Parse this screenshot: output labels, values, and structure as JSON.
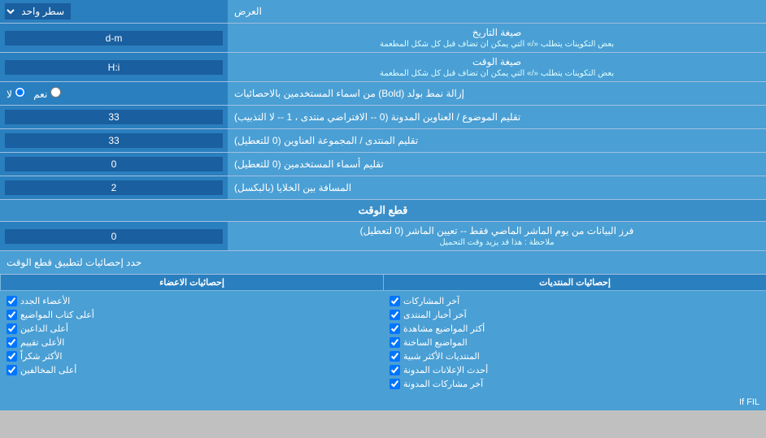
{
  "header": {
    "dropdown_label": "سطر واحد",
    "right_label": "العرض"
  },
  "rows": [
    {
      "id": "date_format",
      "label": "صيغة التاريخ",
      "sublabel": "بعض التكوينات يتطلب «/» التي يمكن ان تضاف قبل كل شكل المطعمة",
      "value": "d-m",
      "type": "text"
    },
    {
      "id": "time_format",
      "label": "صيغة الوقت",
      "sublabel": "بعض التكوينات يتطلب «/» التي يمكن ان تضاف قبل كل شكل المطعمة",
      "value": "H:i",
      "type": "text"
    },
    {
      "id": "bold_remove",
      "label": "إزالة نمط بولد (Bold) من اسماء المستخدمين بالاحصائيات",
      "radio_yes": "نعم",
      "radio_no": "لا",
      "selected": "no",
      "type": "radio"
    },
    {
      "id": "forum_topic",
      "label": "تقليم الموضوع / العناوين المدونة (0 -- الافتراضي منتدى ، 1 -- لا التذبيب)",
      "value": "33",
      "type": "text"
    },
    {
      "id": "forum_group",
      "label": "تقليم المنتدى / المجموعة العناوين (0 للتعطيل)",
      "value": "33",
      "type": "text"
    },
    {
      "id": "user_names",
      "label": "تقليم أسماء المستخدمين (0 للتعطيل)",
      "value": "0",
      "type": "text"
    },
    {
      "id": "entry_distance",
      "label": "المسافة بين الخلايا (بالبكسل)",
      "value": "2",
      "type": "text"
    }
  ],
  "time_cutoff_section": {
    "title": "قطع الوقت",
    "row_label": "فرز البيانات من يوم الماشر الماضي فقط -- تعيين الماشر (0 لتعطيل)",
    "row_note": "ملاحظة : هذا قد يزيد وقت التحميل",
    "row_value": "0"
  },
  "stats_section": {
    "apply_label": "حدد إحصائيات لتطبيق قطع الوقت",
    "col1_header": "إحصائيات المنتديات",
    "col2_header": "إحصائيات الاعضاء",
    "col1_items": [
      "آخر المشاركات",
      "آخر أخبار المنتدى",
      "أكثر المواضيع مشاهدة",
      "المواضيع الساخنة",
      "المنتديات الأكثر شبية",
      "أحدث الإعلانات المدونة",
      "آخر مشاركات المدونة"
    ],
    "col2_items": [
      "الأعضاء الجدد",
      "أعلى كتاب المواضيع",
      "أعلى الداعين",
      "الأعلى تقييم",
      "الأكثر شكراً",
      "أعلى المخالفين"
    ]
  },
  "footer_text": "If FIL"
}
